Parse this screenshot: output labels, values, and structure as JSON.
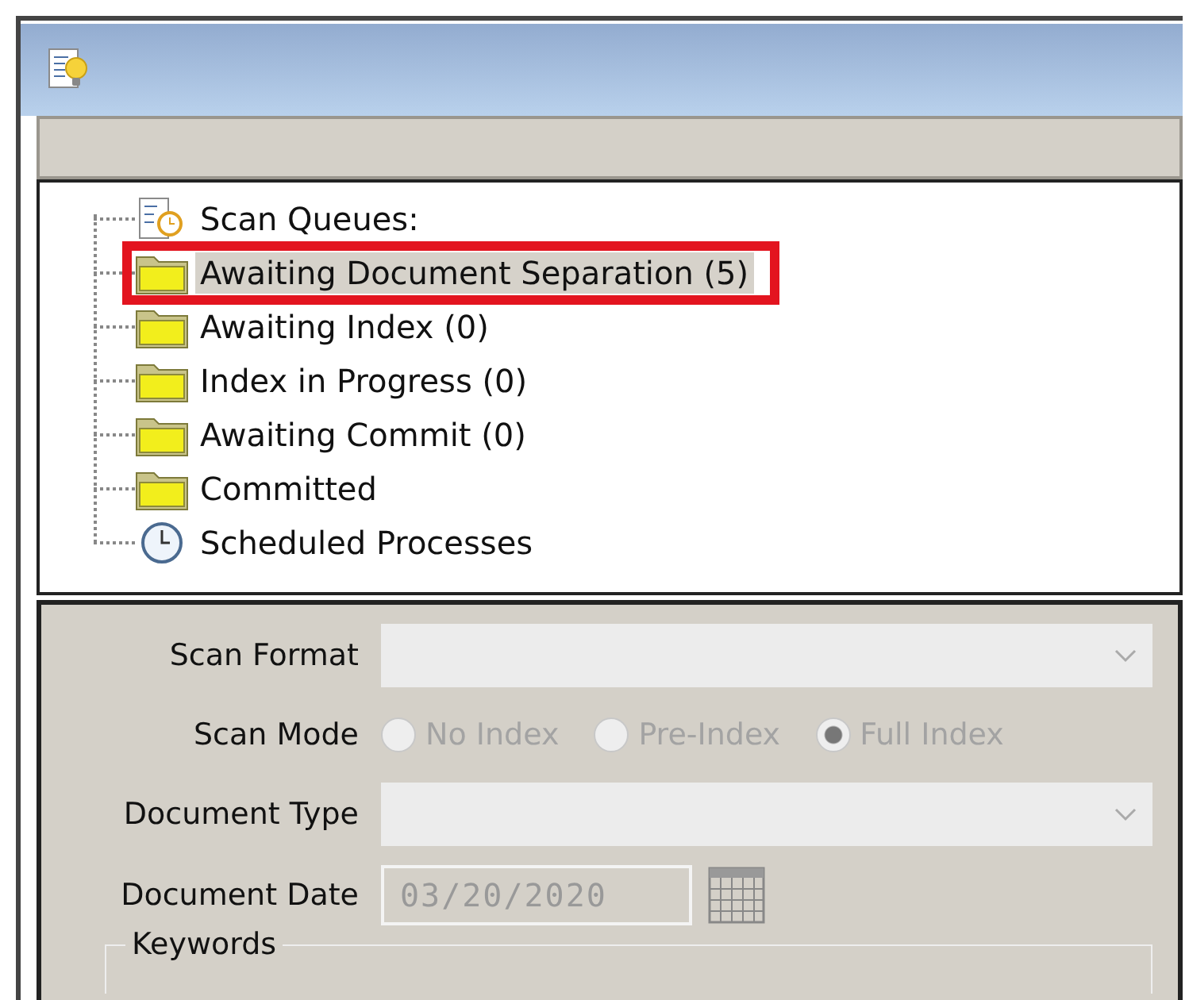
{
  "tree": {
    "items": [
      {
        "label": "Scan Queues:",
        "kind": "queue",
        "selected": false,
        "annotated": false
      },
      {
        "label": "Awaiting Document Separation (5)",
        "kind": "folder",
        "selected": true,
        "annotated": true
      },
      {
        "label": "Awaiting Index (0)",
        "kind": "folder",
        "selected": false,
        "annotated": false
      },
      {
        "label": "Index in Progress (0)",
        "kind": "folder",
        "selected": false,
        "annotated": false
      },
      {
        "label": "Awaiting Commit (0)",
        "kind": "folder",
        "selected": false,
        "annotated": false
      },
      {
        "label": "Committed",
        "kind": "folder",
        "selected": false,
        "annotated": false
      },
      {
        "label": "Scheduled Processes",
        "kind": "clock",
        "selected": false,
        "annotated": false
      }
    ]
  },
  "form": {
    "scan_format": {
      "label": "Scan Format"
    },
    "scan_mode": {
      "label": "Scan Mode",
      "options": [
        {
          "label": "No Index",
          "selected": false
        },
        {
          "label": "Pre-Index",
          "selected": false
        },
        {
          "label": "Full Index",
          "selected": true
        }
      ]
    },
    "document_type": {
      "label": "Document Type"
    },
    "document_date": {
      "label": "Document Date",
      "value": "03/20/2020"
    },
    "keywords": {
      "label": "Keywords"
    }
  }
}
